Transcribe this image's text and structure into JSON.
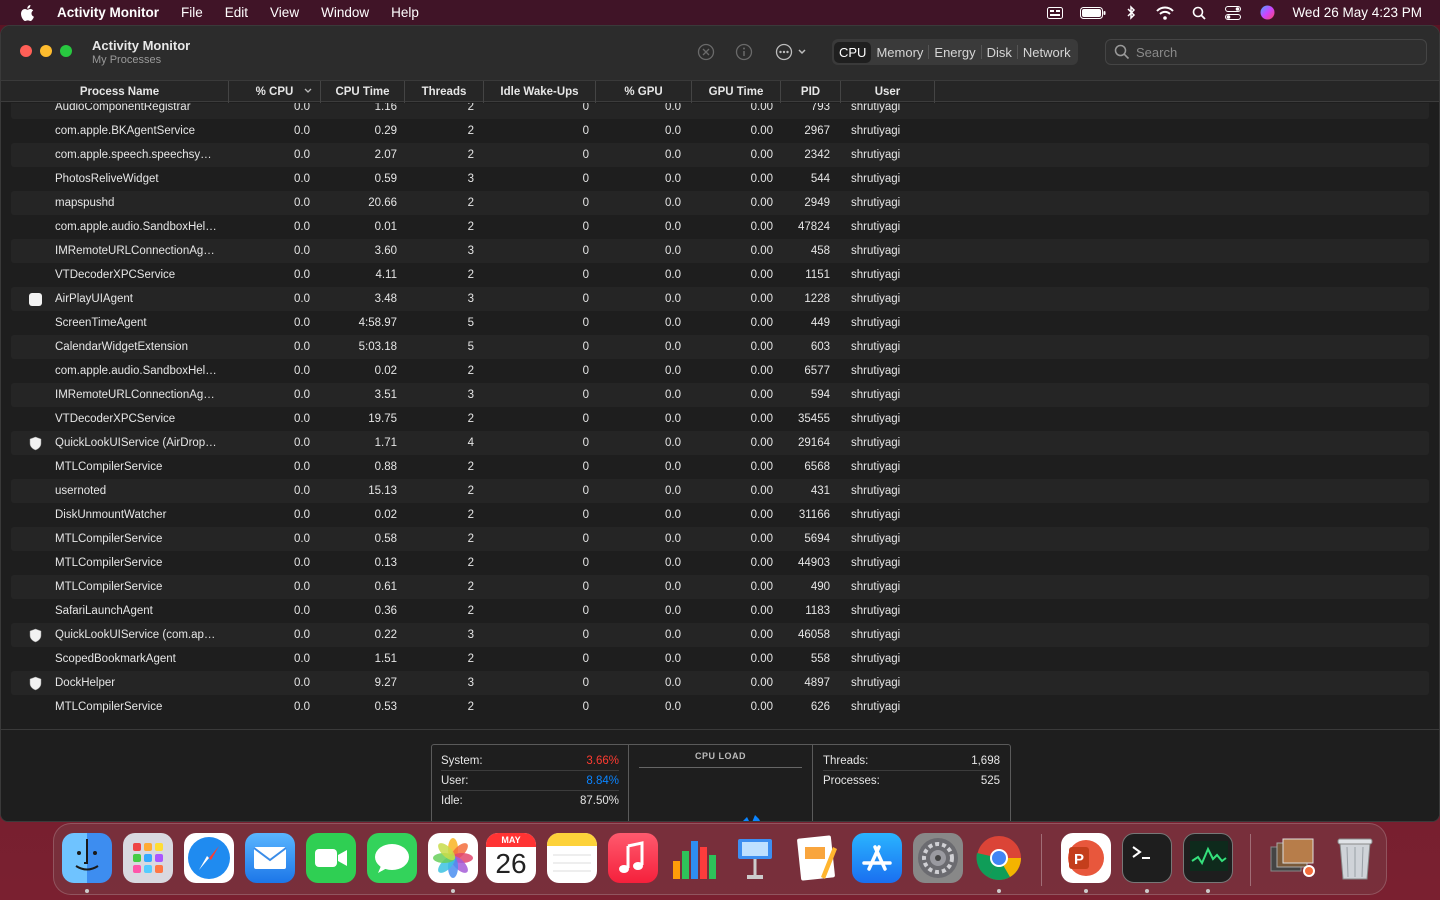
{
  "menubar": {
    "app": "Activity Monitor",
    "items": [
      "File",
      "Edit",
      "View",
      "Window",
      "Help"
    ],
    "clock": "Wed 26 May  4:23 PM",
    "status_icons": [
      "input-menu-icon",
      "battery-icon",
      "bluetooth-icon",
      "wifi-icon",
      "spotlight-icon",
      "control-center-icon",
      "siri-icon"
    ]
  },
  "window": {
    "title": "Activity Monitor",
    "subtitle": "My Processes",
    "tabs": [
      "CPU",
      "Memory",
      "Energy",
      "Disk",
      "Network"
    ],
    "active_tab": "CPU",
    "search_placeholder": "Search"
  },
  "columns": [
    "Process Name",
    "% CPU",
    "CPU Time",
    "Threads",
    "Idle Wake-Ups",
    "% GPU",
    "GPU Time",
    "PID",
    "User"
  ],
  "processes": [
    {
      "name": "AudioComponentRegistrar",
      "cpu": "0.0",
      "time": "1.16",
      "threads": "2",
      "idle": "0",
      "gpu": "0.0",
      "gtime": "0.00",
      "pid": "793",
      "user": "shrutiyagi",
      "icon": ""
    },
    {
      "name": "com.apple.BKAgentService",
      "cpu": "0.0",
      "time": "0.29",
      "threads": "2",
      "idle": "0",
      "gpu": "0.0",
      "gtime": "0.00",
      "pid": "2967",
      "user": "shrutiyagi",
      "icon": ""
    },
    {
      "name": "com.apple.speech.speechsy…",
      "cpu": "0.0",
      "time": "2.07",
      "threads": "2",
      "idle": "0",
      "gpu": "0.0",
      "gtime": "0.00",
      "pid": "2342",
      "user": "shrutiyagi",
      "icon": ""
    },
    {
      "name": "PhotosReliveWidget",
      "cpu": "0.0",
      "time": "0.59",
      "threads": "3",
      "idle": "0",
      "gpu": "0.0",
      "gtime": "0.00",
      "pid": "544",
      "user": "shrutiyagi",
      "icon": ""
    },
    {
      "name": "mapspushd",
      "cpu": "0.0",
      "time": "20.66",
      "threads": "2",
      "idle": "0",
      "gpu": "0.0",
      "gtime": "0.00",
      "pid": "2949",
      "user": "shrutiyagi",
      "icon": ""
    },
    {
      "name": "com.apple.audio.SandboxHel…",
      "cpu": "0.0",
      "time": "0.01",
      "threads": "2",
      "idle": "0",
      "gpu": "0.0",
      "gtime": "0.00",
      "pid": "47824",
      "user": "shrutiyagi",
      "icon": ""
    },
    {
      "name": "IMRemoteURLConnectionAg…",
      "cpu": "0.0",
      "time": "3.60",
      "threads": "3",
      "idle": "0",
      "gpu": "0.0",
      "gtime": "0.00",
      "pid": "458",
      "user": "shrutiyagi",
      "icon": ""
    },
    {
      "name": "VTDecoderXPCService",
      "cpu": "0.0",
      "time": "4.11",
      "threads": "2",
      "idle": "0",
      "gpu": "0.0",
      "gtime": "0.00",
      "pid": "1151",
      "user": "shrutiyagi",
      "icon": ""
    },
    {
      "name": "AirPlayUIAgent",
      "cpu": "0.0",
      "time": "3.48",
      "threads": "3",
      "idle": "0",
      "gpu": "0.0",
      "gtime": "0.00",
      "pid": "1228",
      "user": "shrutiyagi",
      "icon": "airplay-icon"
    },
    {
      "name": "ScreenTimeAgent",
      "cpu": "0.0",
      "time": "4:58.97",
      "threads": "5",
      "idle": "0",
      "gpu": "0.0",
      "gtime": "0.00",
      "pid": "449",
      "user": "shrutiyagi",
      "icon": ""
    },
    {
      "name": "CalendarWidgetExtension",
      "cpu": "0.0",
      "time": "5:03.18",
      "threads": "5",
      "idle": "0",
      "gpu": "0.0",
      "gtime": "0.00",
      "pid": "603",
      "user": "shrutiyagi",
      "icon": ""
    },
    {
      "name": "com.apple.audio.SandboxHel…",
      "cpu": "0.0",
      "time": "0.02",
      "threads": "2",
      "idle": "0",
      "gpu": "0.0",
      "gtime": "0.00",
      "pid": "6577",
      "user": "shrutiyagi",
      "icon": ""
    },
    {
      "name": "IMRemoteURLConnectionAg…",
      "cpu": "0.0",
      "time": "3.51",
      "threads": "3",
      "idle": "0",
      "gpu": "0.0",
      "gtime": "0.00",
      "pid": "594",
      "user": "shrutiyagi",
      "icon": ""
    },
    {
      "name": "VTDecoderXPCService",
      "cpu": "0.0",
      "time": "19.75",
      "threads": "2",
      "idle": "0",
      "gpu": "0.0",
      "gtime": "0.00",
      "pid": "35455",
      "user": "shrutiyagi",
      "icon": ""
    },
    {
      "name": "QuickLookUIService (AirDrop…",
      "cpu": "0.0",
      "time": "1.71",
      "threads": "4",
      "idle": "0",
      "gpu": "0.0",
      "gtime": "0.00",
      "pid": "29164",
      "user": "shrutiyagi",
      "icon": "shield-icon"
    },
    {
      "name": "MTLCompilerService",
      "cpu": "0.0",
      "time": "0.88",
      "threads": "2",
      "idle": "0",
      "gpu": "0.0",
      "gtime": "0.00",
      "pid": "6568",
      "user": "shrutiyagi",
      "icon": ""
    },
    {
      "name": "usernoted",
      "cpu": "0.0",
      "time": "15.13",
      "threads": "2",
      "idle": "0",
      "gpu": "0.0",
      "gtime": "0.00",
      "pid": "431",
      "user": "shrutiyagi",
      "icon": ""
    },
    {
      "name": "DiskUnmountWatcher",
      "cpu": "0.0",
      "time": "0.02",
      "threads": "2",
      "idle": "0",
      "gpu": "0.0",
      "gtime": "0.00",
      "pid": "31166",
      "user": "shrutiyagi",
      "icon": ""
    },
    {
      "name": "MTLCompilerService",
      "cpu": "0.0",
      "time": "0.58",
      "threads": "2",
      "idle": "0",
      "gpu": "0.0",
      "gtime": "0.00",
      "pid": "5694",
      "user": "shrutiyagi",
      "icon": ""
    },
    {
      "name": "MTLCompilerService",
      "cpu": "0.0",
      "time": "0.13",
      "threads": "2",
      "idle": "0",
      "gpu": "0.0",
      "gtime": "0.00",
      "pid": "44903",
      "user": "shrutiyagi",
      "icon": ""
    },
    {
      "name": "MTLCompilerService",
      "cpu": "0.0",
      "time": "0.61",
      "threads": "2",
      "idle": "0",
      "gpu": "0.0",
      "gtime": "0.00",
      "pid": "490",
      "user": "shrutiyagi",
      "icon": ""
    },
    {
      "name": "SafariLaunchAgent",
      "cpu": "0.0",
      "time": "0.36",
      "threads": "2",
      "idle": "0",
      "gpu": "0.0",
      "gtime": "0.00",
      "pid": "1183",
      "user": "shrutiyagi",
      "icon": ""
    },
    {
      "name": "QuickLookUIService (com.ap…",
      "cpu": "0.0",
      "time": "0.22",
      "threads": "3",
      "idle": "0",
      "gpu": "0.0",
      "gtime": "0.00",
      "pid": "46058",
      "user": "shrutiyagi",
      "icon": "shield-icon"
    },
    {
      "name": "ScopedBookmarkAgent",
      "cpu": "0.0",
      "time": "1.51",
      "threads": "2",
      "idle": "0",
      "gpu": "0.0",
      "gtime": "0.00",
      "pid": "558",
      "user": "shrutiyagi",
      "icon": ""
    },
    {
      "name": "DockHelper",
      "cpu": "0.0",
      "time": "9.27",
      "threads": "3",
      "idle": "0",
      "gpu": "0.0",
      "gtime": "0.00",
      "pid": "4897",
      "user": "shrutiyagi",
      "icon": "shield-icon"
    },
    {
      "name": "MTLCompilerService",
      "cpu": "0.0",
      "time": "0.53",
      "threads": "2",
      "idle": "0",
      "gpu": "0.0",
      "gtime": "0.00",
      "pid": "626",
      "user": "shrutiyagi",
      "icon": ""
    }
  ],
  "summary": {
    "system_label": "System:",
    "system_value": "3.66%",
    "user_label": "User:",
    "user_value": "8.84%",
    "idle_label": "Idle:",
    "idle_value": "87.50%",
    "cpuload_title": "CPU LOAD",
    "threads_label": "Threads:",
    "threads_value": "1,698",
    "processes_label": "Processes:",
    "processes_value": "525"
  },
  "calendar_icon": {
    "month": "MAY",
    "day": "26"
  },
  "dock": [
    "finder",
    "launchpad",
    "safari",
    "mail",
    "facetime",
    "messages",
    "photos",
    "calendar",
    "notes",
    "music",
    "numbers",
    "keynote",
    "pages",
    "app-store",
    "system-preferences",
    "chrome",
    "powerpoint",
    "terminal",
    "activity-monitor",
    "photo-stack",
    "trash"
  ]
}
